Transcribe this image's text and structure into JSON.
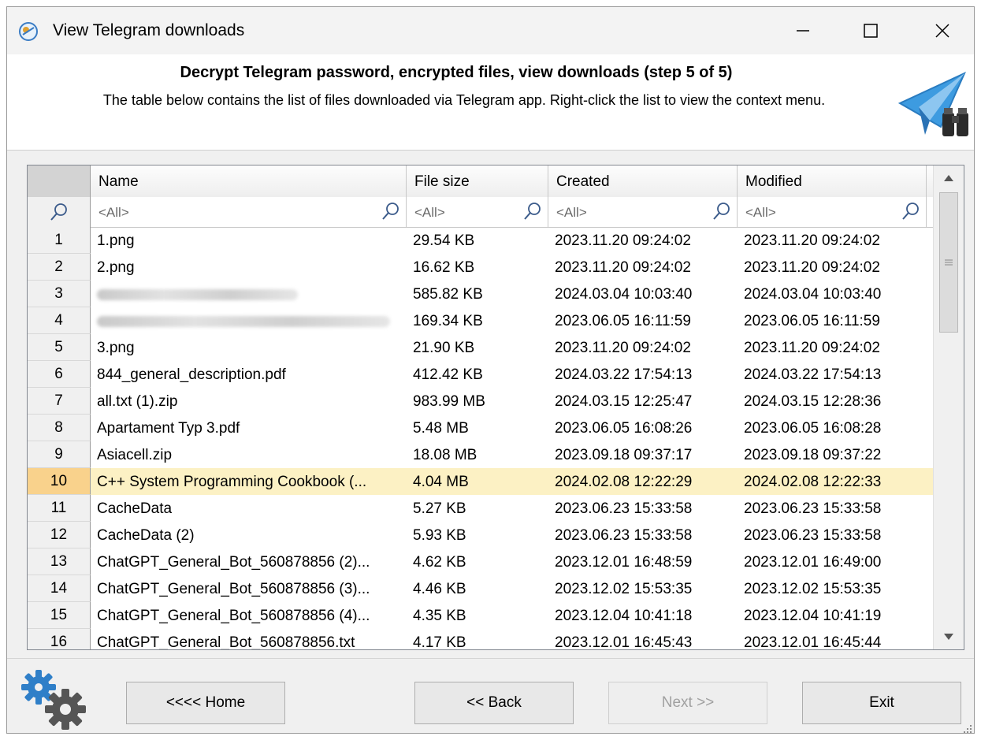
{
  "window": {
    "title": "View Telegram downloads",
    "controls": {
      "minimize": "minimize",
      "maximize": "maximize",
      "close": "close"
    }
  },
  "header": {
    "title": "Decrypt Telegram password, encrypted files, view downloads (step 5 of 5)",
    "description": "The table below contains the list of files downloaded via Telegram app. Right-click the list to view the context menu."
  },
  "table": {
    "columns": [
      "Name",
      "File size",
      "Created",
      "Modified"
    ],
    "filter_placeholder": "<All>",
    "rows": [
      {
        "num": "1",
        "name": "1.png",
        "size": "29.54 KB",
        "created": "2023.11.20 09:24:02",
        "modified": "2023.11.20 09:24:02"
      },
      {
        "num": "2",
        "name": "2.png",
        "size": "16.62 KB",
        "created": "2023.11.20 09:24:02",
        "modified": "2023.11.20 09:24:02"
      },
      {
        "num": "3",
        "name": "",
        "redacted": true,
        "size": "585.82 KB",
        "created": "2024.03.04 10:03:40",
        "modified": "2024.03.04 10:03:40"
      },
      {
        "num": "4",
        "name": "",
        "redacted": true,
        "size": "169.34 KB",
        "created": "2023.06.05 16:11:59",
        "modified": "2023.06.05 16:11:59"
      },
      {
        "num": "5",
        "name": "3.png",
        "size": "21.90 KB",
        "created": "2023.11.20 09:24:02",
        "modified": "2023.11.20 09:24:02"
      },
      {
        "num": "6",
        "name": "844_general_description.pdf",
        "size": "412.42 KB",
        "created": "2024.03.22 17:54:13",
        "modified": "2024.03.22 17:54:13"
      },
      {
        "num": "7",
        "name": "all.txt (1).zip",
        "size": "983.99 MB",
        "created": "2024.03.15 12:25:47",
        "modified": "2024.03.15 12:28:36"
      },
      {
        "num": "8",
        "name": "Apartament Typ 3.pdf",
        "size": "5.48 MB",
        "created": "2023.06.05 16:08:26",
        "modified": "2023.06.05 16:08:28"
      },
      {
        "num": "9",
        "name": "Asiacell.zip",
        "size": "18.08 MB",
        "created": "2023.09.18 09:37:17",
        "modified": "2023.09.18 09:37:22"
      },
      {
        "num": "10",
        "name": "C++ System Programming Cookbook (...",
        "size": "4.04 MB",
        "created": "2024.02.08 12:22:29",
        "modified": "2024.02.08 12:22:33",
        "selected": true
      },
      {
        "num": "11",
        "name": "CacheData",
        "size": "5.27 KB",
        "created": "2023.06.23 15:33:58",
        "modified": "2023.06.23 15:33:58"
      },
      {
        "num": "12",
        "name": "CacheData (2)",
        "size": "5.93 KB",
        "created": "2023.06.23 15:33:58",
        "modified": "2023.06.23 15:33:58"
      },
      {
        "num": "13",
        "name": "ChatGPT_General_Bot_560878856 (2)...",
        "size": "4.62 KB",
        "created": "2023.12.01 16:48:59",
        "modified": "2023.12.01 16:49:00"
      },
      {
        "num": "14",
        "name": "ChatGPT_General_Bot_560878856 (3)...",
        "size": "4.46 KB",
        "created": "2023.12.02 15:53:35",
        "modified": "2023.12.02 15:53:35"
      },
      {
        "num": "15",
        "name": "ChatGPT_General_Bot_560878856 (4)...",
        "size": "4.35 KB",
        "created": "2023.12.04 10:41:18",
        "modified": "2023.12.04 10:41:19"
      },
      {
        "num": "16",
        "name": "ChatGPT_General_Bot_560878856.txt",
        "size": "4.17 KB",
        "created": "2023.12.01 16:45:43",
        "modified": "2023.12.01 16:45:44"
      }
    ]
  },
  "buttons": {
    "home": "<<<< Home",
    "back": "<< Back",
    "next": "Next >>",
    "exit": "Exit"
  },
  "colors": {
    "selected_row": "#fcf1c4",
    "selected_rownum": "#f9d28c",
    "accent_blue": "#2f8fd8"
  }
}
